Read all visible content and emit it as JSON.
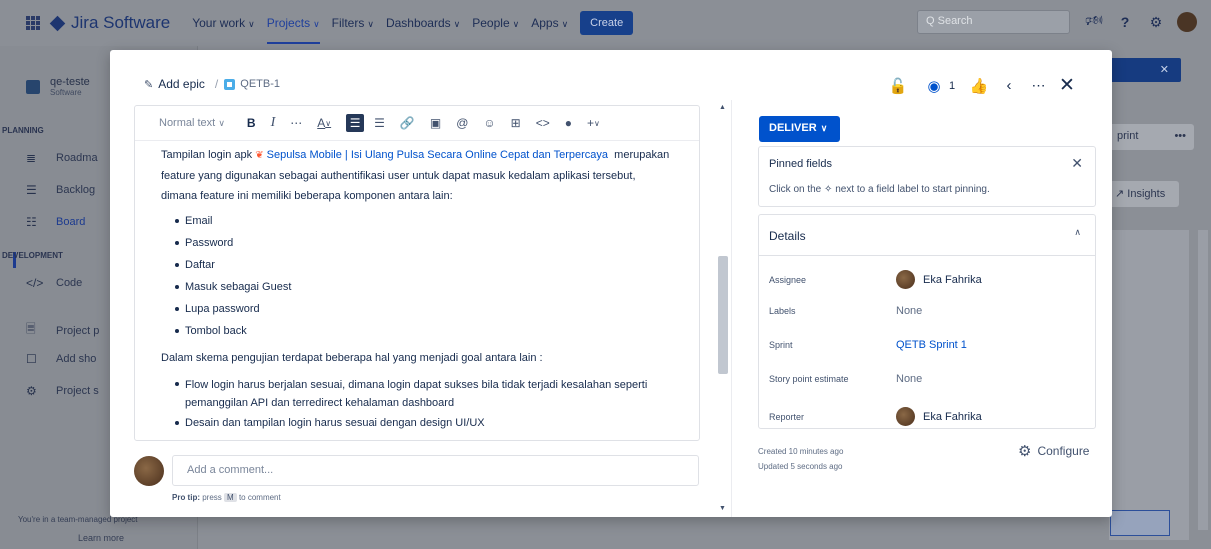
{
  "topnav": {
    "product": "Jira Software",
    "items": [
      {
        "label": "Your work"
      },
      {
        "label": "Projects"
      },
      {
        "label": "Filters"
      },
      {
        "label": "Dashboards"
      },
      {
        "label": "People"
      },
      {
        "label": "Apps"
      }
    ],
    "create_label": "Create",
    "search_placeholder": "Q  Search"
  },
  "sidebar": {
    "project_name": "qe-teste",
    "project_type": "Software",
    "planning_label": "PLANNING",
    "development_label": "DEVELOPMENT",
    "items": [
      {
        "label": "Roadma",
        "icon": "roadmap-icon"
      },
      {
        "label": "Backlog",
        "icon": "backlog-icon"
      },
      {
        "label": "Board",
        "icon": "board-icon"
      },
      {
        "label": "Code",
        "icon": "code-icon"
      },
      {
        "label": "Project p",
        "icon": "page-icon"
      },
      {
        "label": "Add sho",
        "icon": "add-shortcut-icon"
      },
      {
        "label": "Project s",
        "icon": "settings-icon"
      }
    ],
    "team_text": "You're in a team-managed project",
    "learn_more": "Learn more"
  },
  "background": {
    "sprint_button": "print",
    "more": "•••",
    "insights_button": "Insights"
  },
  "issue": {
    "add_epic": "Add epic",
    "separator": "/",
    "key": "QETB-1",
    "watch_count": "1"
  },
  "editor": {
    "text_style": "Normal text",
    "intro_prefix": "Tampilan login apk",
    "smart_link": "Sepulsa Mobile | Isi Ulang Pulsa Secara Online Cepat dan Terpercaya",
    "intro_suffix": "merupakan feature yang digunakan sebagai authentifikasi user untuk dapat masuk kedalam aplikasi tersebut, dimana feature ini memiliki beberapa komponen antara lain:",
    "components": [
      "Email",
      "Password",
      "Daftar",
      "Masuk sebagai Guest",
      "Lupa password",
      "Tombol back"
    ],
    "goal_intro": "Dalam skema pengujian terdapat beberapa hal yang menjadi goal antara lain :",
    "goals": [
      "Flow login harus berjalan sesuai, dimana login dapat sukses bila tidak terjadi kesalahan seperti pemanggilan API dan terredirect kehalaman dashboard",
      "Desain dan tampilan login harus sesuai dengan design UI/UX"
    ]
  },
  "comment": {
    "placeholder": "Add a comment...",
    "protip_label": "Pro tip:",
    "protip_pre": "press",
    "protip_key": "M",
    "protip_post": "to comment"
  },
  "side": {
    "status": "DELIVER",
    "pinned_title": "Pinned fields",
    "pinned_msg_pre": "Click on the",
    "pinned_msg_post": "next to a field label to start pinning.",
    "details_title": "Details",
    "fields": [
      {
        "label": "Assignee",
        "value": "Eka Fahrika"
      },
      {
        "label": "Labels",
        "value": "None"
      },
      {
        "label": "Sprint",
        "value": "QETB Sprint 1"
      },
      {
        "label": "Story point estimate",
        "value": "None"
      },
      {
        "label": "Reporter",
        "value": "Eka Fahrika"
      }
    ],
    "created": "Created 10 minutes ago",
    "updated": "Updated 5 seconds ago",
    "configure": "Configure"
  },
  "colors": {
    "accent": "#0052cc",
    "overlay": "#8b8f96",
    "status_button": "#0052cc"
  }
}
